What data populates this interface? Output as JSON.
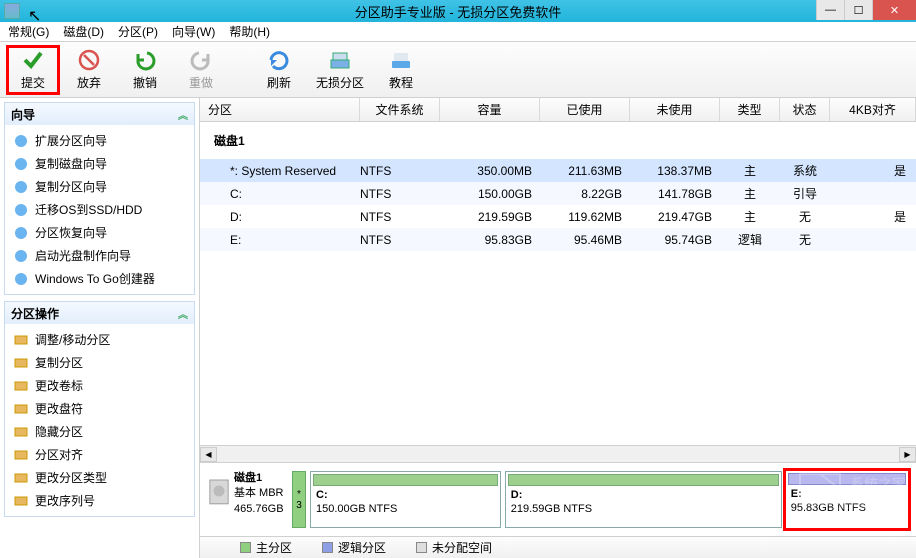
{
  "window": {
    "title": "分区助手专业版 - 无损分区免费软件",
    "min": "—",
    "max": "☐",
    "close": "✕"
  },
  "menu": {
    "general": "常规(G)",
    "disk": "磁盘(D)",
    "partition": "分区(P)",
    "wizard": "向导(W)",
    "help": "帮助(H)"
  },
  "toolbar": {
    "commit": "提交",
    "discard": "放弃",
    "undo": "撤销",
    "redo": "重做",
    "refresh": "刷新",
    "lossless": "无损分区",
    "tutorial": "教程"
  },
  "panels": {
    "wizard": {
      "title": "向导",
      "items": [
        {
          "label": "扩展分区向导"
        },
        {
          "label": "复制磁盘向导"
        },
        {
          "label": "复制分区向导"
        },
        {
          "label": "迁移OS到SSD/HDD"
        },
        {
          "label": "分区恢复向导"
        },
        {
          "label": "启动光盘制作向导"
        },
        {
          "label": "Windows To Go创建器"
        }
      ]
    },
    "ops": {
      "title": "分区操作",
      "items": [
        {
          "label": "调整/移动分区"
        },
        {
          "label": "复制分区"
        },
        {
          "label": "更改卷标"
        },
        {
          "label": "更改盘符"
        },
        {
          "label": "隐藏分区"
        },
        {
          "label": "分区对齐"
        },
        {
          "label": "更改分区类型"
        },
        {
          "label": "更改序列号"
        }
      ]
    }
  },
  "grid": {
    "headers": {
      "c1": "分区",
      "c2": "文件系统",
      "c3": "容量",
      "c4": "已使用",
      "c5": "未使用",
      "c6": "类型",
      "c7": "状态",
      "c8": "4KB对齐"
    },
    "disk_title": "磁盘1",
    "rows": [
      {
        "p": "*: System Reserved",
        "fs": "NTFS",
        "cap": "350.00MB",
        "used": "211.63MB",
        "free": "138.37MB",
        "type": "主",
        "state": "系统",
        "align": "是"
      },
      {
        "p": "C:",
        "fs": "NTFS",
        "cap": "150.00GB",
        "used": "8.22GB",
        "free": "141.78GB",
        "type": "主",
        "state": "引导",
        "align": ""
      },
      {
        "p": "D:",
        "fs": "NTFS",
        "cap": "219.59GB",
        "used": "119.62MB",
        "free": "219.47GB",
        "type": "主",
        "state": "无",
        "align": "是"
      },
      {
        "p": "E:",
        "fs": "NTFS",
        "cap": "95.83GB",
        "used": "95.46MB",
        "free": "95.74GB",
        "type": "逻辑",
        "state": "无",
        "align": ""
      }
    ]
  },
  "diskmap": {
    "disk_name": "磁盘1",
    "disk_type": "基本 MBR",
    "disk_size": "465.76GB",
    "slim_top": "*",
    "slim_bot": "3",
    "c_label": "C:",
    "c_size": "150.00GB NTFS",
    "d_label": "D:",
    "d_size": "219.59GB NTFS",
    "e_label": "E:",
    "e_size": "95.83GB NTFS"
  },
  "legend": {
    "primary": "主分区",
    "logical": "逻辑分区",
    "unalloc": "未分配空间"
  },
  "colors": {
    "primary_sw": "#8fcf7f",
    "logical_sw": "#8f9fe6",
    "unalloc_sw": "#dedede"
  }
}
